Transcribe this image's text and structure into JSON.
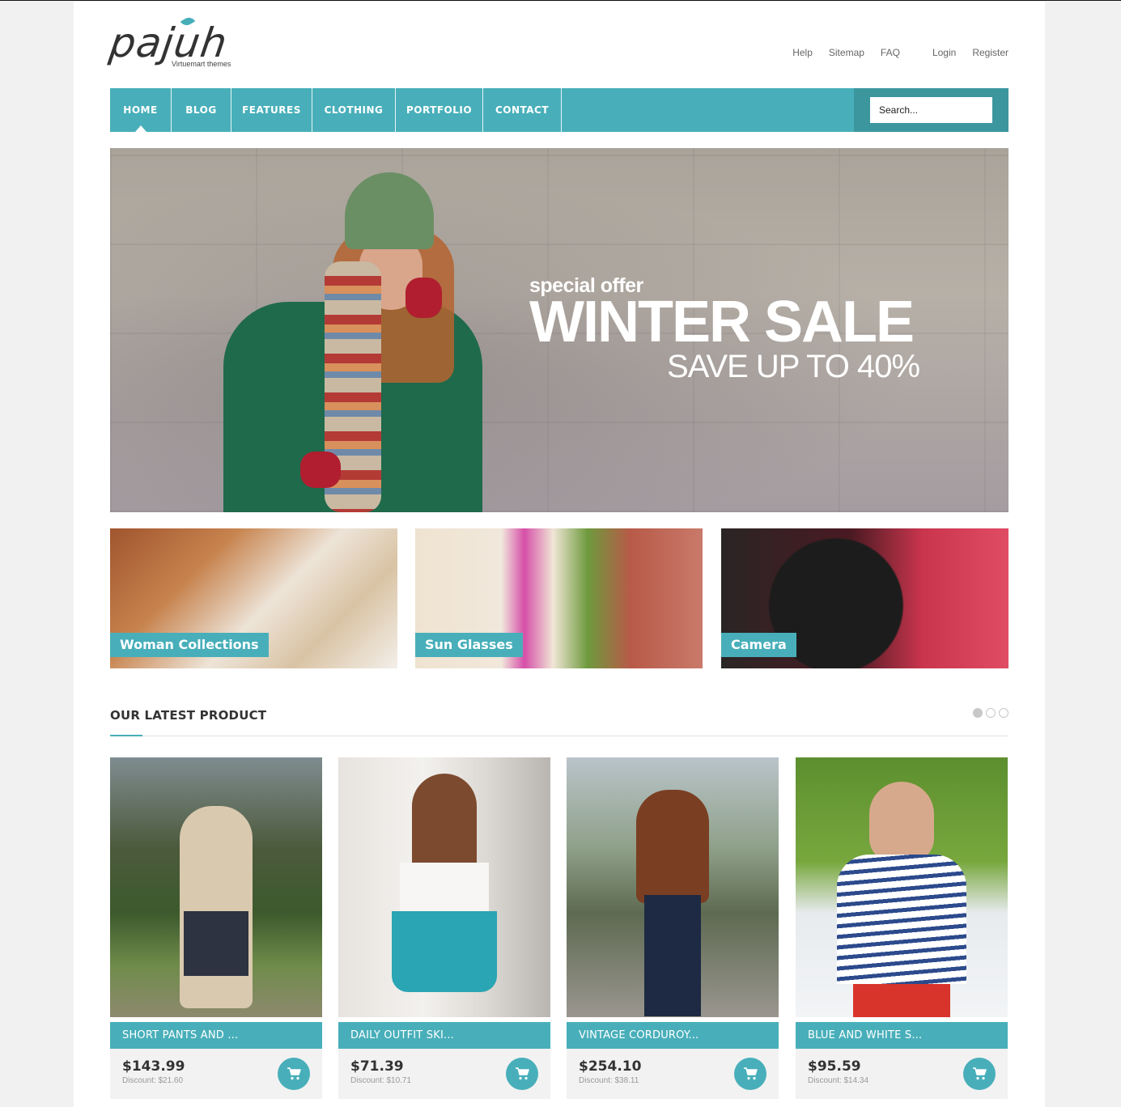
{
  "brand": {
    "name": "pajuh",
    "tagline": "Virtuemart themes",
    "accent_color": "#48afba",
    "accent_dark": "#3c969e"
  },
  "top_links": [
    {
      "label": "Help"
    },
    {
      "label": "Sitemap"
    },
    {
      "label": "FAQ"
    },
    {
      "label": "Login"
    },
    {
      "label": "Register"
    }
  ],
  "nav": {
    "items": [
      {
        "label": "HOME",
        "active": true
      },
      {
        "label": "BLOG",
        "active": false
      },
      {
        "label": "FEATURES",
        "active": false
      },
      {
        "label": "CLOTHING",
        "active": false
      },
      {
        "label": "PORTFOLIO",
        "active": false
      },
      {
        "label": "CONTACT",
        "active": false
      }
    ],
    "search_placeholder": "Search..."
  },
  "hero": {
    "subtitle": "special offer",
    "title": "WINTER SALE",
    "tagline": "SAVE UP TO 40%"
  },
  "categories": [
    {
      "label": "Woman Collections"
    },
    {
      "label": "Sun Glasses"
    },
    {
      "label": "Camera"
    }
  ],
  "latest": {
    "title": "OUR LATEST PRODUCT",
    "pages": 3,
    "current_page": 1,
    "products": [
      {
        "name": "SHORT PANTS AND ...",
        "price": "$143.99",
        "discount": "Discount: $21.60"
      },
      {
        "name": "DAILY OUTFIT SKI...",
        "price": "$71.39",
        "discount": "Discount: $10.71"
      },
      {
        "name": "VINTAGE CORDUROY...",
        "price": "$254.10",
        "discount": "Discount: $38.11"
      },
      {
        "name": "BLUE AND WHITE S...",
        "price": "$95.59",
        "discount": "Discount: $14.34"
      }
    ]
  }
}
